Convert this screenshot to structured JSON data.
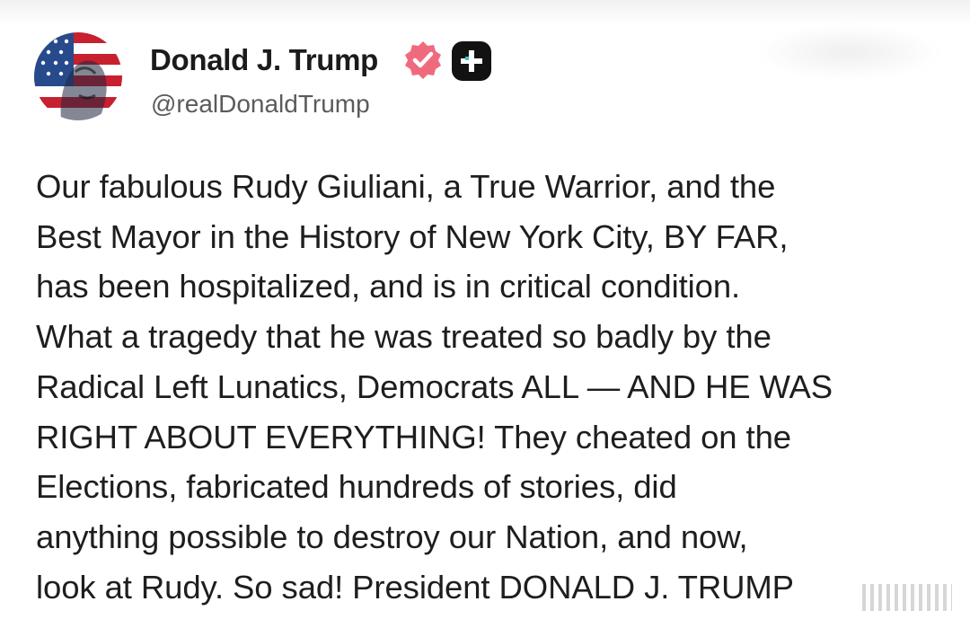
{
  "author": {
    "display_name": "Donald J. Trump",
    "handle": "@realDonaldTrump",
    "verified_icon": "verified-badge-icon",
    "plus_icon": "plus-square-icon"
  },
  "colors": {
    "verified_badge": "#f06a7e",
    "plus_badge": "#121212",
    "name_text": "#1b1b1b",
    "handle_text": "#5b5b5b",
    "body_text": "#1e1e1e"
  },
  "post": {
    "lines": [
      "Our fabulous Rudy Giuliani, a True Warrior, and the",
      "Best Mayor in the History of New York City, BY FAR,",
      "has been hospitalized, and is in critical condition.",
      "What a tragedy that he was treated so badly by the",
      "Radical Left Lunatics, Democrats ALL — AND HE WAS",
      "RIGHT ABOUT EVERYTHING! They cheated on the",
      "Elections, fabricated hundreds of stories, did",
      "anything possible to destroy our Nation, and now,",
      "look at Rudy. So sad! President DONALD J. TRUMP"
    ]
  }
}
